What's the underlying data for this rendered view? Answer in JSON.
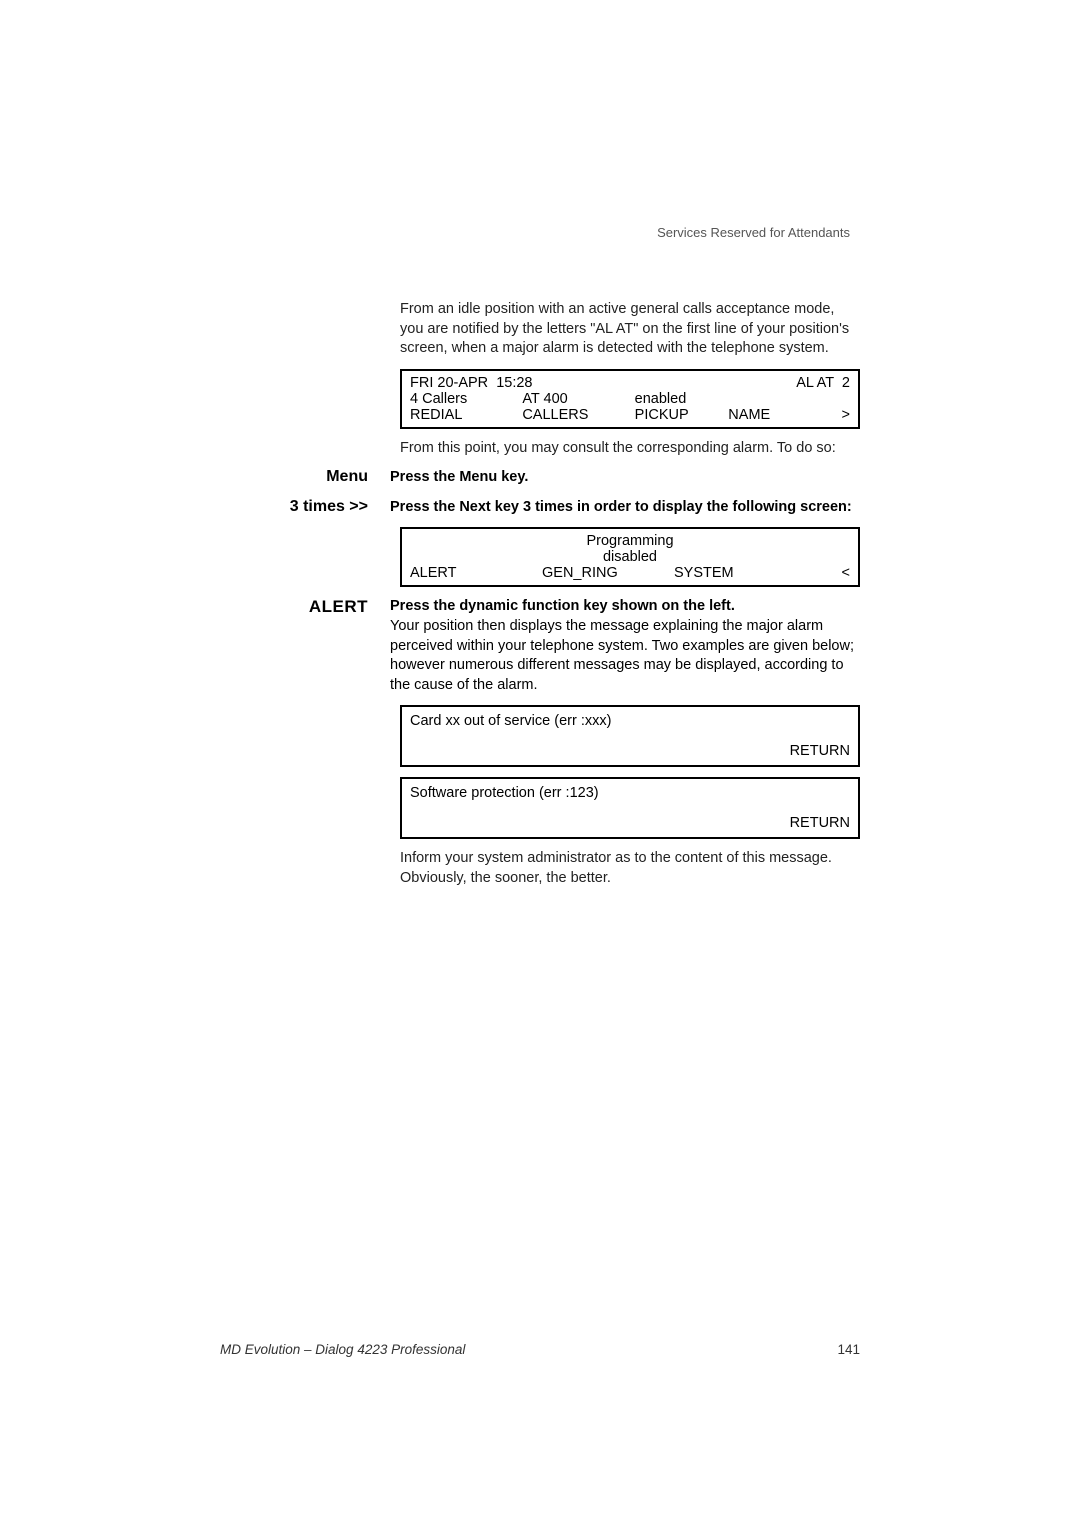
{
  "header": {
    "section_title": "Services Reserved for Attendants"
  },
  "para1": "From an idle position with an active general calls acceptance mode, you are notified by the letters \"AL AT\" on the first line of your position's screen, when a major alarm is detected with the telephone system.",
  "screen1": {
    "row1_left": "FRI 20-APR  15:28",
    "row1_right": "AL AT  2",
    "row2_c1": "  4 Callers",
    "row2_c2": "AT 400",
    "row2_c3": "enabled",
    "row3_c1": "REDIAL",
    "row3_c2": "CALLERS",
    "row3_c3": "PICKUP",
    "row3_c4": "NAME",
    "row3_c5": ">"
  },
  "para2": "From this point, you may consult the corresponding alarm. To do so:",
  "step1": {
    "key": "Menu",
    "text": "Press the Menu key."
  },
  "step2": {
    "key": "3 times  >>",
    "text": "Press the Next key 3 times in order to display the following screen:"
  },
  "screen2": {
    "row1_center": "Programming",
    "row2_center": "disabled",
    "row3_c1": "ALERT",
    "row3_c2": "GEN_RING",
    "row3_c3": "SYSTEM",
    "row3_c4": "<"
  },
  "step3": {
    "key": "ALERT",
    "bold": "Press the dynamic function key shown on the left.",
    "text": "Your position then displays the message explaining the major alarm perceived within your telephone system. Two examples are given below; however numerous different messages may be displayed, according to the cause of the alarm."
  },
  "screen3": {
    "line1": "Card xx out of service (err :xxx)",
    "return": "RETURN"
  },
  "screen4": {
    "line1": "Software protection (err :123)",
    "return": "RETURN"
  },
  "para3": "Inform your system administrator as to the content of this message. Obviously, the sooner, the better.",
  "footer": {
    "left": "MD Evolution – Dialog 4223 Professional",
    "right": "141"
  }
}
